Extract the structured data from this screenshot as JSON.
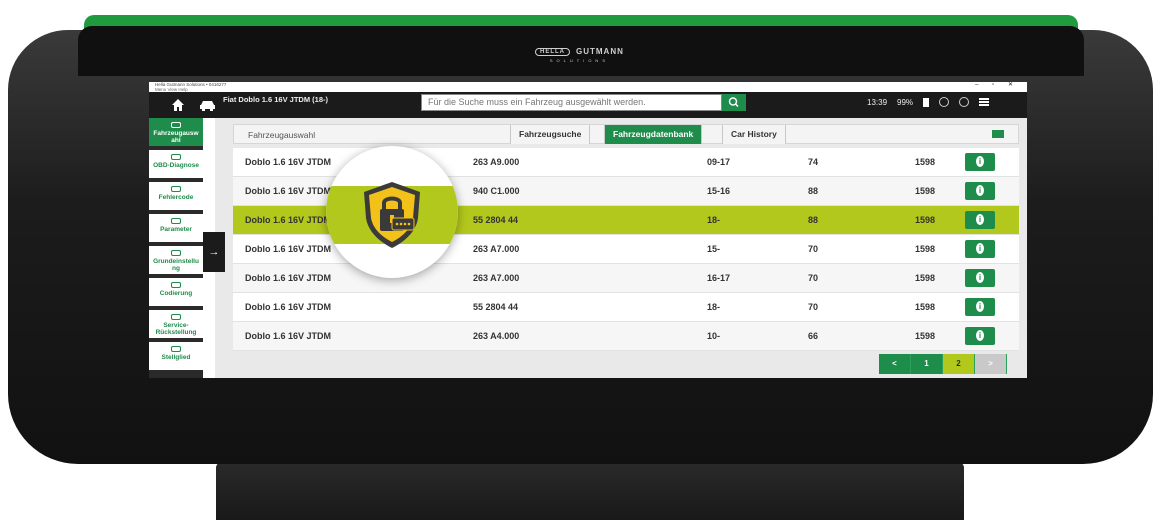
{
  "device": {
    "brand_main": "GUTMANN",
    "brand_oval": "HELLA",
    "brand_sub": "SOLUTIONS"
  },
  "window": {
    "title": "Hella Gutmann Solutions • 0416277",
    "menu": "Menu  View  Help",
    "controls": "– ▫ ✕"
  },
  "topbar": {
    "vehicle": "Fiat Doblo 1.6 16V JTDM (18-)",
    "search_placeholder": "Für die Suche muss ein Fahrzeug ausgewählt werden.",
    "time": "13:39",
    "battery": "99%"
  },
  "sidebar": {
    "items": [
      {
        "label": "Fahrzeugausw ahl",
        "icon": "car-icon",
        "active": true
      },
      {
        "label": "OBD-Diagnose",
        "icon": "obd-icon",
        "active": false
      },
      {
        "label": "Fehlercode",
        "icon": "error-code-icon",
        "active": false
      },
      {
        "label": "Parameter",
        "icon": "parameter-icon",
        "active": false
      },
      {
        "label": "Grundeinstellu ng",
        "icon": "wrench-icon",
        "active": false
      },
      {
        "label": "Codierung",
        "icon": "coding-icon",
        "active": false
      },
      {
        "label": "Service-Rückstellung",
        "icon": "service-icon",
        "active": false
      },
      {
        "label": "Stellglied",
        "icon": "actuator-icon",
        "active": false
      }
    ],
    "expand_arrow": "→"
  },
  "content": {
    "page_label": "Fahrzeugauswahl",
    "tabs": [
      {
        "label": "Fahrzeugsuche",
        "active": false
      },
      {
        "label": "Fahrzeugdatenbank",
        "active": true
      },
      {
        "label": "Car History",
        "active": false
      }
    ],
    "rows": [
      {
        "name": "Doblo 1.6 16V JTDM",
        "code": "263 A9.000",
        "years": "09-17",
        "kw": "74",
        "ccm": "1598"
      },
      {
        "name": "Doblo 1.6 16V JTDM",
        "code": "940 C1.000",
        "years": "15-16",
        "kw": "88",
        "ccm": "1598"
      },
      {
        "name": "Doblo 1.6 16V JTDM",
        "code": "55 2804 44",
        "years": "18-",
        "kw": "88",
        "ccm": "1598"
      },
      {
        "name": "Doblo 1.6 16V JTDM",
        "code": "263 A7.000",
        "years": "15-",
        "kw": "70",
        "ccm": "1598"
      },
      {
        "name": "Doblo 1.6 16V JTDM",
        "code": "263 A7.000",
        "years": "16-17",
        "kw": "70",
        "ccm": "1598"
      },
      {
        "name": "Doblo 1.6 16V JTDM",
        "code": "55 2804 44",
        "years": "18-",
        "kw": "70",
        "ccm": "1598"
      },
      {
        "name": "Doblo 1.6 16V JTDM",
        "code": "263 A4.000",
        "years": "10-",
        "kw": "66",
        "ccm": "1598"
      }
    ],
    "highlighted_row": 2,
    "pager": {
      "prev": "<",
      "pages": [
        "1",
        "2"
      ],
      "current": "2",
      "next": ">"
    }
  },
  "colors": {
    "accent_green": "#1e8c4a",
    "highlight_lime": "#b3c81c",
    "shield_yellow": "#f2c21a"
  }
}
